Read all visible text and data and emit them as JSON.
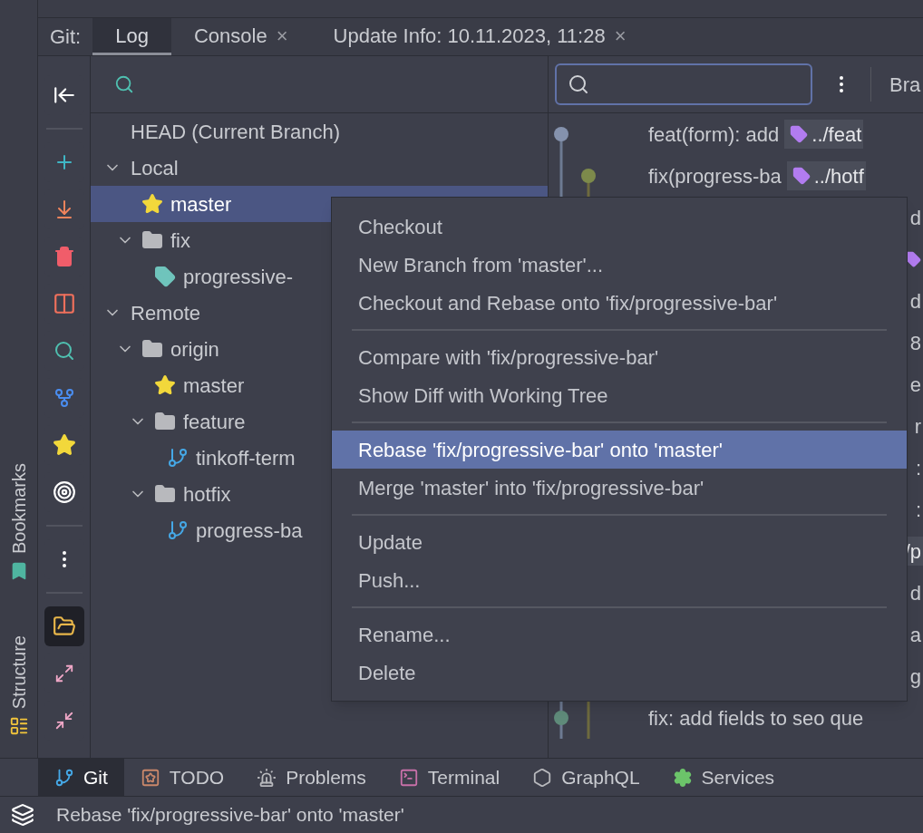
{
  "tool_window": {
    "label": "Git:",
    "tabs": [
      {
        "label": "Log",
        "selected": true
      },
      {
        "label": "Console",
        "selected": false,
        "close": "×"
      },
      {
        "label": "Update Info: 10.11.2023, 11:28",
        "selected": false,
        "close": "×"
      }
    ]
  },
  "side_strip": [
    {
      "label": "Bookmarks",
      "kind": "bookmarks"
    },
    {
      "label": "Structure",
      "kind": "structure"
    }
  ],
  "toolbar": [
    {
      "kind": "collapse-panel",
      "selected": false
    },
    {
      "kind": "separator"
    },
    {
      "kind": "new-branch",
      "selected": false
    },
    {
      "kind": "update",
      "selected": false
    },
    {
      "kind": "delete",
      "selected": false
    },
    {
      "kind": "compare",
      "selected": false
    },
    {
      "kind": "search",
      "selected": false
    },
    {
      "kind": "fetch",
      "selected": false
    },
    {
      "kind": "favorite",
      "selected": false
    },
    {
      "kind": "target",
      "selected": false
    },
    {
      "kind": "separator"
    },
    {
      "kind": "more",
      "selected": false
    },
    {
      "kind": "separator"
    },
    {
      "kind": "group-by-directory",
      "selected": true
    },
    {
      "kind": "expand",
      "selected": false
    },
    {
      "kind": "collapse",
      "selected": false
    }
  ],
  "branches": [
    {
      "label": "HEAD (Current Branch)",
      "selected": false
    },
    {
      "label": "Local",
      "expanded": true,
      "selected": false,
      "children": [
        {
          "label": "master",
          "kind": "favorite",
          "selected": true
        },
        {
          "label": "fix",
          "kind": "folder",
          "expanded": true,
          "selected": false,
          "children": [
            {
              "label": "progressive-",
              "kind": "tag",
              "selected": false
            }
          ]
        }
      ]
    },
    {
      "label": "Remote",
      "expanded": true,
      "selected": false,
      "children": [
        {
          "label": "origin",
          "kind": "folder",
          "expanded": true,
          "selected": false,
          "children": [
            {
              "label": "master",
              "kind": "favorite",
              "selected": false
            },
            {
              "label": "feature",
              "kind": "folder",
              "expanded": true,
              "selected": false,
              "children": [
                {
                  "label": "tinkoff-term",
                  "kind": "branch",
                  "selected": false
                }
              ]
            },
            {
              "label": "hotfix",
              "kind": "folder",
              "expanded": true,
              "selected": false,
              "children": [
                {
                  "label": "progress-ba",
                  "kind": "branch",
                  "selected": false
                }
              ]
            }
          ]
        }
      ]
    }
  ],
  "log": {
    "branch_filter": "Bra",
    "commits": [
      {
        "kind": "left",
        "message": "feat(form): add",
        "ref": "../feat",
        "color": "#8592ad"
      },
      {
        "kind": "right",
        "message": "fix(progress-ba",
        "ref": "../hotf",
        "color": "#7d8a4b"
      },
      {
        "kind": "cut",
        "message": "d"
      },
      {
        "kind": "tag-cut"
      },
      {
        "kind": "cut",
        "message": "d"
      },
      {
        "kind": "cut",
        "message": "8"
      },
      {
        "kind": "cut",
        "message": "e"
      },
      {
        "kind": "cut",
        "message": "r"
      },
      {
        "kind": "cut",
        "message": ":"
      },
      {
        "kind": "cut",
        "message": ":"
      },
      {
        "kind": "ref-cut",
        "message": "/p"
      },
      {
        "kind": "cut",
        "message": "d"
      },
      {
        "kind": "cut",
        "message": "a"
      },
      {
        "kind": "cut",
        "message": "g"
      },
      {
        "kind": "left",
        "message": "fix: add fields to seo que",
        "color": "#5f8b7a"
      }
    ]
  },
  "context_menu": [
    [
      {
        "label": "Checkout",
        "selected": false
      },
      {
        "label": "New Branch from 'master'...",
        "selected": false
      },
      {
        "label": "Checkout and Rebase onto 'fix/progressive-bar'",
        "selected": false
      }
    ],
    [
      {
        "label": "Compare with 'fix/progressive-bar'",
        "selected": false
      },
      {
        "label": "Show Diff with Working Tree",
        "selected": false
      }
    ],
    [
      {
        "label": "Rebase 'fix/progressive-bar' onto 'master'",
        "selected": true
      },
      {
        "label": "Merge 'master' into 'fix/progressive-bar'",
        "selected": false
      }
    ],
    [
      {
        "label": "Update",
        "selected": false
      },
      {
        "label": "Push...",
        "selected": false
      }
    ],
    [
      {
        "label": "Rename...",
        "selected": false
      },
      {
        "label": "Delete",
        "selected": false
      }
    ]
  ],
  "bottom_tabs": [
    {
      "label": "Git",
      "kind": "git",
      "selected": true
    },
    {
      "label": "TODO",
      "kind": "todo",
      "selected": false
    },
    {
      "label": "Problems",
      "kind": "problems",
      "selected": false
    },
    {
      "label": "Terminal",
      "kind": "terminal",
      "selected": false
    },
    {
      "label": "GraphQL",
      "kind": "graphql",
      "selected": false
    },
    {
      "label": "Services",
      "kind": "services",
      "selected": false
    }
  ],
  "status_bar": {
    "message": "Rebase 'fix/progressive-bar' onto 'master'"
  }
}
